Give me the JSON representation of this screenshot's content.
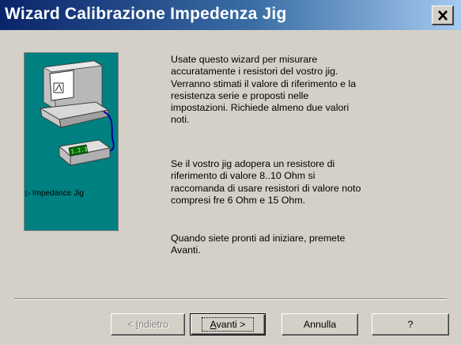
{
  "window": {
    "title": "Wizard Calibrazione Impedenza Jig"
  },
  "illustration": {
    "label": "Impedance Jig",
    "display_text": "1.2.3"
  },
  "content": {
    "paragraph1": [
      "Usate questo wizard per misurare",
      "accuratamente i resistori del vostro jig.",
      "Verranno stimati il valore di riferimento e la",
      "resistenza serie e proposti nelle",
      "impostazioni. Richiede almeno due valori",
      "noti."
    ],
    "paragraph2": [
      "Se il vostro jig adopera un resistore di",
      "riferimento di valore 8..10 Ohm si",
      "raccomanda di usare resistori di valore noto",
      "compresi fre 6 Ohm e 15 Ohm."
    ],
    "paragraph3": [
      "Quando siete pronti ad iniziare, premete",
      "Avanti."
    ]
  },
  "buttons": {
    "back_prefix": "< ",
    "back_mnemonic": "I",
    "back_rest": "ndietro",
    "next_mnemonic": "A",
    "next_rest": "vanti >",
    "cancel": "Annulla",
    "help": "?"
  }
}
